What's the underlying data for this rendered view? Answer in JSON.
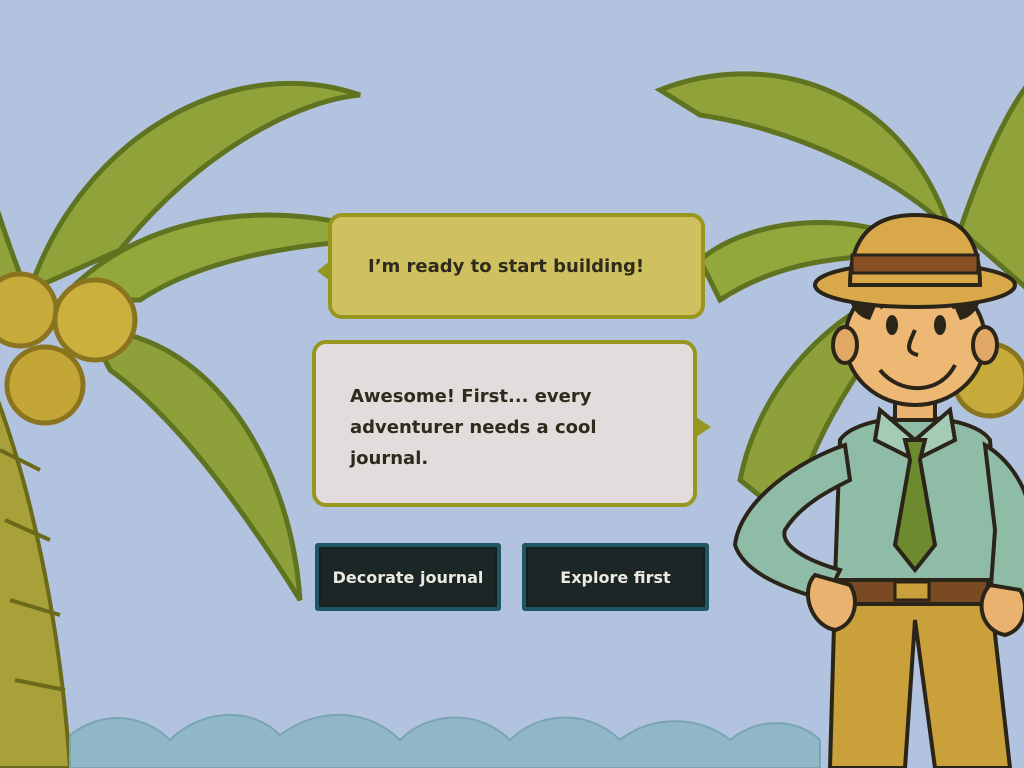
{
  "dialogue": {
    "player_line": "I’m ready to start building!",
    "npc_line": "Awesome! First... every adventurer needs a cool journal."
  },
  "choices": {
    "decorate_label": "Decorate journal",
    "explore_label": "Explore first"
  },
  "colors": {
    "sky": "#b1c3de",
    "player_bubble": "#cfc160",
    "npc_bubble": "#e2dcdc",
    "bubble_border": "#97961e",
    "button_fill": "#1d2626",
    "button_border": "#1e5662",
    "button_text": "#eceae0",
    "water": "#8fb7c6"
  },
  "icons": {
    "character": "explorer-guide",
    "scenery": "palm-tree"
  }
}
